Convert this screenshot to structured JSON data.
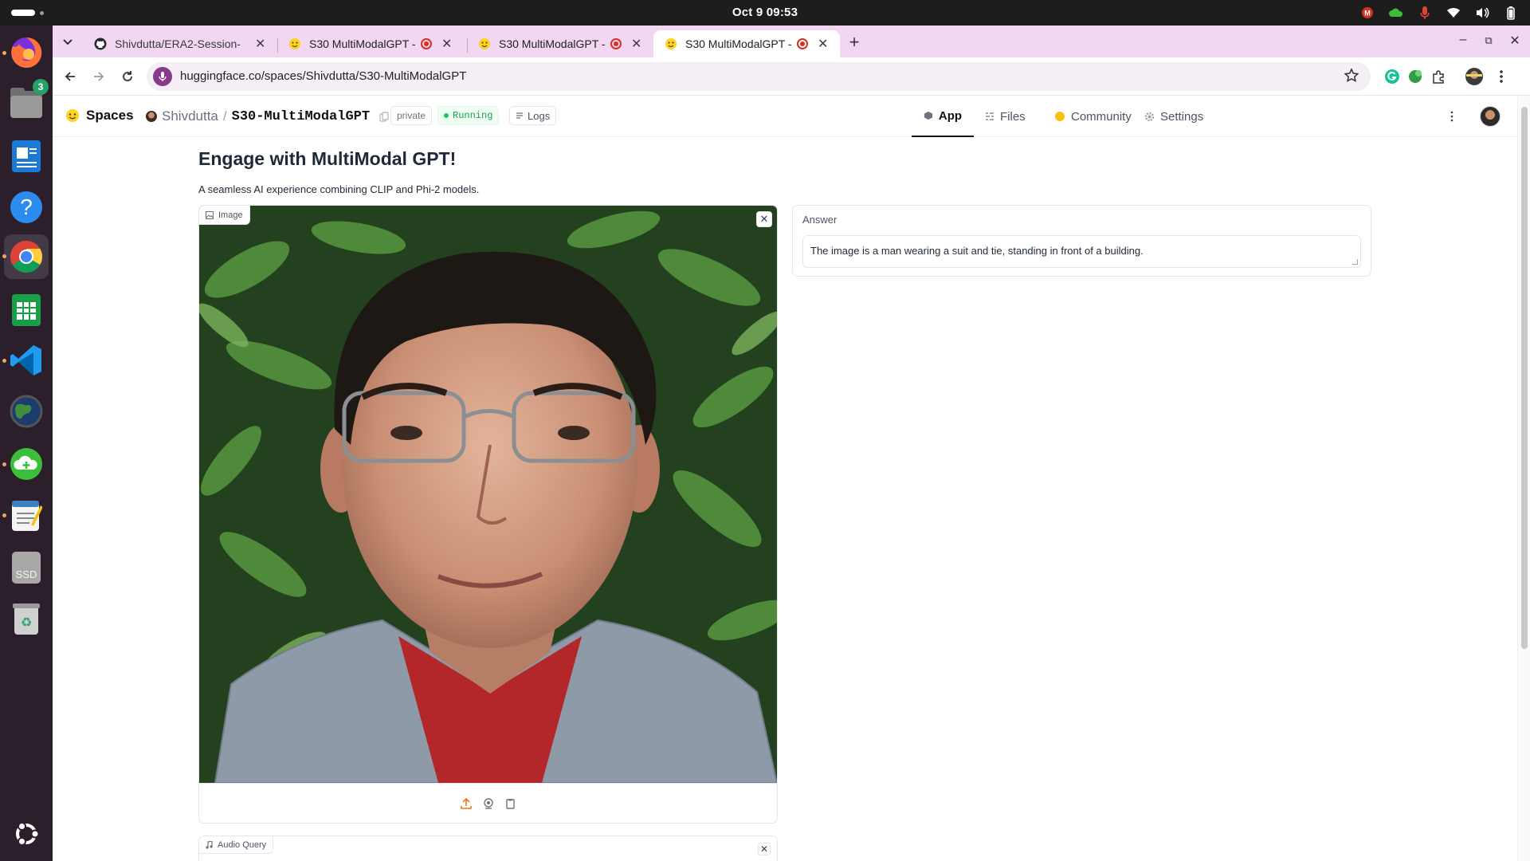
{
  "system": {
    "clock": "Oct 9  09:53",
    "colors": {
      "topbar": "#1d1d1d",
      "dock": "#2b1f2c",
      "tabstrip": "#f2d7f2",
      "record": "#d93025"
    }
  },
  "dock": {
    "items": [
      {
        "name": "firefox",
        "icon": "firefox-icon"
      },
      {
        "name": "files",
        "icon": "folder-icon",
        "badge": "3"
      },
      {
        "name": "writer",
        "icon": "document-icon"
      },
      {
        "name": "help",
        "icon": "question-icon"
      },
      {
        "name": "chrome",
        "icon": "chrome-icon"
      },
      {
        "name": "calc",
        "icon": "spreadsheet-icon"
      },
      {
        "name": "vscode",
        "icon": "vscode-icon"
      },
      {
        "name": "earth",
        "icon": "globe-icon"
      },
      {
        "name": "cloud",
        "icon": "cloud-icon"
      },
      {
        "name": "text-editor",
        "icon": "notepad-icon"
      },
      {
        "name": "ssd",
        "icon": "drive-icon",
        "label": "SSD"
      },
      {
        "name": "trash",
        "icon": "trash-icon"
      },
      {
        "name": "apps",
        "icon": "ubuntu-icon"
      }
    ]
  },
  "browser": {
    "tabs": [
      {
        "title": "Shivdutta/ERA2-Session-"
      },
      {
        "title": "S30 MultiModalGPT -"
      },
      {
        "title": "S30 MultiModalGPT -"
      },
      {
        "title": "S30 MultiModalGPT -"
      }
    ],
    "new_tab": "+",
    "url": "huggingface.co/spaces/Shivdutta/S30-MultiModalGPT"
  },
  "hf": {
    "spaces_label": "Spaces",
    "owner": "Shivdutta",
    "repo": "S30-MultiModalGPT",
    "private_label": "private",
    "running_label": "Running",
    "logs_label": "Logs",
    "nav": {
      "app": "App",
      "files": "Files",
      "community": "Community",
      "settings": "Settings"
    }
  },
  "app": {
    "title": "Engage with MultiModal GPT!",
    "description": "A seamless AI experience combining CLIP and Phi-2 models.",
    "image_label": "Image",
    "answer_label": "Answer",
    "answer_text": "The image is a man wearing a suit and tie, standing in front of a building.",
    "audio_label": "Audio Query"
  }
}
